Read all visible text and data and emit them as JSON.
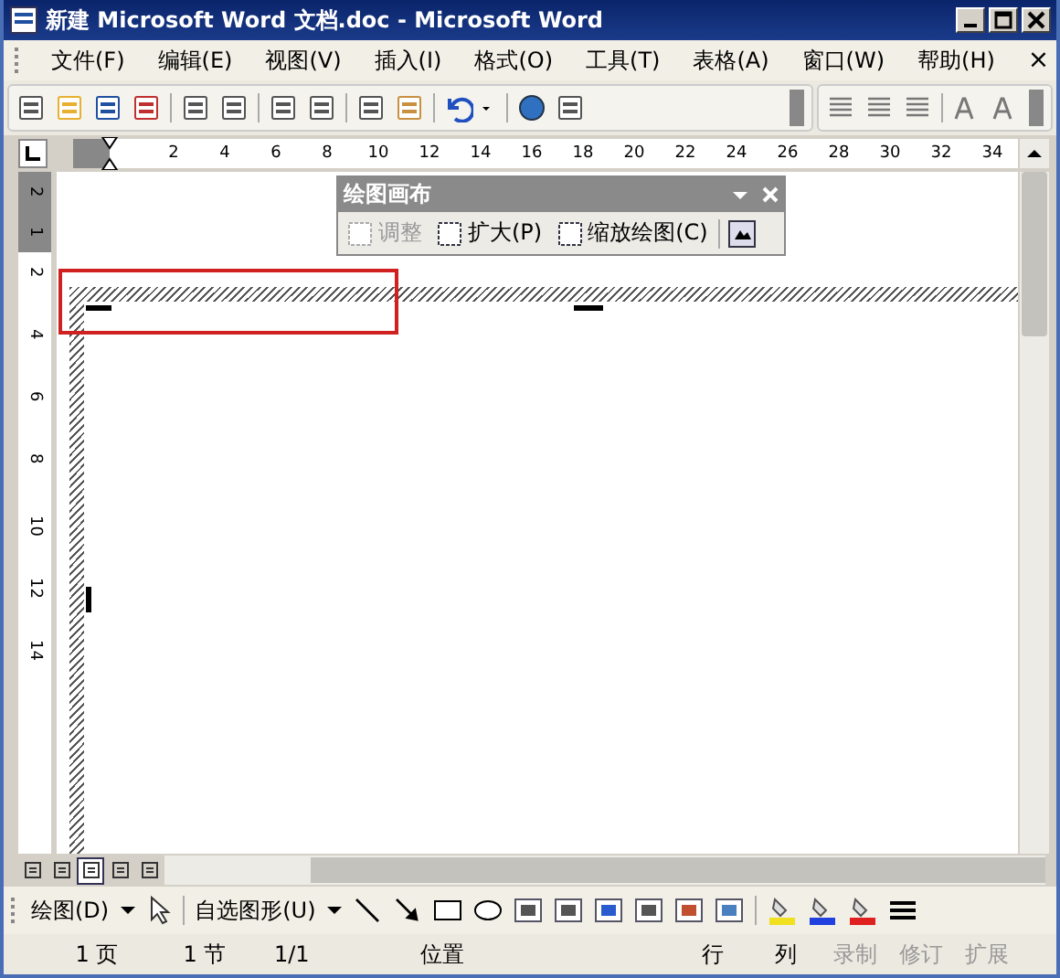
{
  "window": {
    "title": "新建 Microsoft Word 文档.doc - Microsoft Word"
  },
  "menu": [
    "文件(F)",
    "编辑(E)",
    "视图(V)",
    "插入(I)",
    "格式(O)",
    "工具(T)",
    "表格(A)",
    "窗口(W)",
    "帮助(H)"
  ],
  "menu_close": "×",
  "ruler": {
    "ticks": [
      "2",
      "4",
      "6",
      "8",
      "10",
      "12",
      "14",
      "16",
      "18",
      "20",
      "22",
      "24",
      "26",
      "28",
      "30",
      "32",
      "34"
    ]
  },
  "vertical_ruler": {
    "ticks": [
      {
        "label": "2",
        "margin": true
      },
      {
        "label": "1",
        "margin": true
      },
      {
        "label": "2",
        "margin": false
      },
      {
        "label": "4",
        "margin": false
      },
      {
        "label": "6",
        "margin": false
      },
      {
        "label": "8",
        "margin": false
      },
      {
        "label": "10",
        "margin": false
      },
      {
        "label": "12",
        "margin": false
      },
      {
        "label": "14",
        "margin": false
      }
    ]
  },
  "canvas_toolbar": {
    "title": "绘图画布",
    "buttons": [
      {
        "label": "调整",
        "disabled": true
      },
      {
        "label": "扩大(P)",
        "disabled": false
      },
      {
        "label": "缩放绘图(C)",
        "disabled": false
      }
    ]
  },
  "view_modes": [
    {
      "selected": false
    },
    {
      "selected": false
    },
    {
      "selected": true
    },
    {
      "selected": false
    },
    {
      "selected": false
    }
  ],
  "drawing_toolbar": {
    "draw_menu": "绘图(D)",
    "autoshapes_menu": "自选图形(U)"
  },
  "status_bar": [
    {
      "text": "1 页",
      "disabled": false
    },
    {
      "text": "1 节",
      "disabled": false
    },
    {
      "text": "1/1",
      "disabled": false
    },
    {
      "text": "位置",
      "disabled": false
    },
    {
      "text": "行",
      "disabled": false
    },
    {
      "text": "列",
      "disabled": false
    },
    {
      "text": "录制",
      "disabled": true
    },
    {
      "text": "修订",
      "disabled": true
    },
    {
      "text": "扩展",
      "disabled": true
    }
  ]
}
